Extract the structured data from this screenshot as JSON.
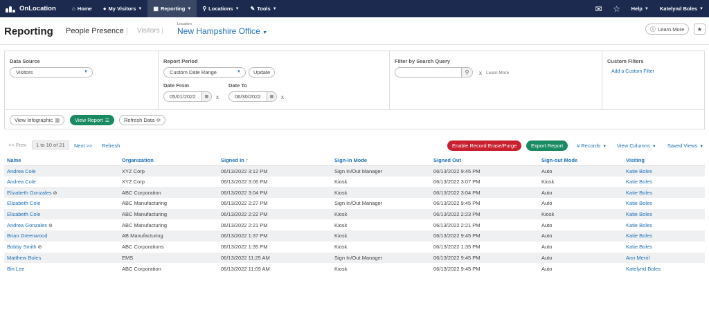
{
  "app": {
    "name": "OnLocation"
  },
  "nav": {
    "items": [
      {
        "label": "Home",
        "icon": "home-icon",
        "glyph": "⌂"
      },
      {
        "label": "My Visitors",
        "icon": "user-icon",
        "glyph": "●"
      },
      {
        "label": "Reporting",
        "icon": "chart-icon",
        "glyph": "▦"
      },
      {
        "label": "Locations",
        "icon": "sitemap-icon",
        "glyph": "⚲"
      },
      {
        "label": "Tools",
        "icon": "wrench-icon",
        "glyph": "✎"
      }
    ],
    "help": "Help",
    "user": "Katelynd Boles"
  },
  "header": {
    "title": "Reporting",
    "tab_active": "People Presence",
    "tab_other": "Visitors",
    "location_label": "Location",
    "location_value": "New Hampshire Office",
    "learn_more": "Learn More"
  },
  "filters": {
    "data_source_label": "Data Source",
    "data_source_value": "Visitors",
    "report_period_label": "Report Period",
    "report_period_value": "Custom Date Range",
    "update": "Update",
    "date_from_label": "Date From",
    "date_from": "05/01/2022",
    "date_to_label": "Date To",
    "date_to": "06/30/2022",
    "search_label": "Filter by Search Query",
    "search_value": "",
    "search_learn_more": "Learn More",
    "custom_label": "Custom Filters",
    "custom_link": "Add a Custom Filter",
    "clear": "x"
  },
  "actions": {
    "view_infographic": "View Infographic",
    "view_report": "View Report",
    "refresh_data": "Refresh Data"
  },
  "toolbar": {
    "prev": "<< Prev",
    "page_info": "1 to 10 of 21",
    "next": "Next >>",
    "refresh": "Refresh",
    "erase": "Enable Record Erase/Purge",
    "export": "Export Report",
    "records": "# Records",
    "view_columns": "View Columns",
    "saved_views": "Saved Views"
  },
  "table": {
    "columns": [
      "Name",
      "Organization",
      "Signed In ↑",
      "Sign-in Mode",
      "Signed Out",
      "Sign-out Mode",
      "Visiting"
    ],
    "rows": [
      {
        "name": "Andrea Cole",
        "banned": false,
        "org": "XYZ Corp",
        "signed_in": "06/13/2022 3:12 PM",
        "in_mode": "Sign In/Out Manager",
        "signed_out": "06/13/2022 9:45 PM",
        "out_mode": "Auto",
        "visiting": "Katie Boles"
      },
      {
        "name": "Andrea Cole",
        "banned": false,
        "org": "XYZ Corp",
        "signed_in": "06/13/2022 3:06 PM",
        "in_mode": "Kiosk",
        "signed_out": "06/13/2022 3:07 PM",
        "out_mode": "Kiosk",
        "visiting": "Katie Boles"
      },
      {
        "name": "Elizabeth Gonzales",
        "banned": true,
        "org": "ABC Corporation",
        "signed_in": "06/13/2022 3:04 PM",
        "in_mode": "Kiosk",
        "signed_out": "06/13/2022 3:04 PM",
        "out_mode": "Auto",
        "visiting": "Katie Boles"
      },
      {
        "name": "Elizabeth Cole",
        "banned": false,
        "org": "ABC Manufacturing",
        "signed_in": "06/13/2022 2:27 PM",
        "in_mode": "Sign In/Out Manager",
        "signed_out": "06/13/2022 9:45 PM",
        "out_mode": "Auto",
        "visiting": "Katie Boles"
      },
      {
        "name": "Elizabeth Cole",
        "banned": false,
        "org": "ABC Manufacturing",
        "signed_in": "06/13/2022 2:22 PM",
        "in_mode": "Kiosk",
        "signed_out": "06/13/2022 2:23 PM",
        "out_mode": "Kiosk",
        "visiting": "Katie Boles"
      },
      {
        "name": "Andrea Gonzales",
        "banned": true,
        "org": "ABC Manufacturing",
        "signed_in": "06/13/2022 2:21 PM",
        "in_mode": "Kiosk",
        "signed_out": "06/13/2022 2:21 PM",
        "out_mode": "Auto",
        "visiting": "Katie Boles"
      },
      {
        "name": "Brian Greenwood",
        "banned": false,
        "org": "AB Manufacturing",
        "signed_in": "06/13/2022 1:37 PM",
        "in_mode": "Kiosk",
        "signed_out": "06/13/2022 9:45 PM",
        "out_mode": "Auto",
        "visiting": "Katie Boles"
      },
      {
        "name": "Bobby Smith",
        "banned": true,
        "org": "ABC Corporations",
        "signed_in": "06/13/2022 1:35 PM",
        "in_mode": "Kiosk",
        "signed_out": "06/13/2022 1:35 PM",
        "out_mode": "Auto",
        "visiting": "Katie Boles"
      },
      {
        "name": "Matthew Boles",
        "banned": false,
        "org": "EMS",
        "signed_in": "06/13/2022 11:25 AM",
        "in_mode": "Sign In/Out Manager",
        "signed_out": "06/13/2022 9:45 PM",
        "out_mode": "Auto",
        "visiting": "Ann Merril"
      },
      {
        "name": "Bin Lee",
        "banned": false,
        "org": "ABC Corporation",
        "signed_in": "06/13/2022 11:09 AM",
        "in_mode": "Kiosk",
        "signed_out": "06/13/2022 9:45 PM",
        "out_mode": "Auto",
        "visiting": "Katelynd Boles"
      }
    ]
  },
  "colors": {
    "nav_bg": "#1b2a4e",
    "link": "#1f6fb5",
    "green": "#1a8a62",
    "red": "#c8202f"
  }
}
